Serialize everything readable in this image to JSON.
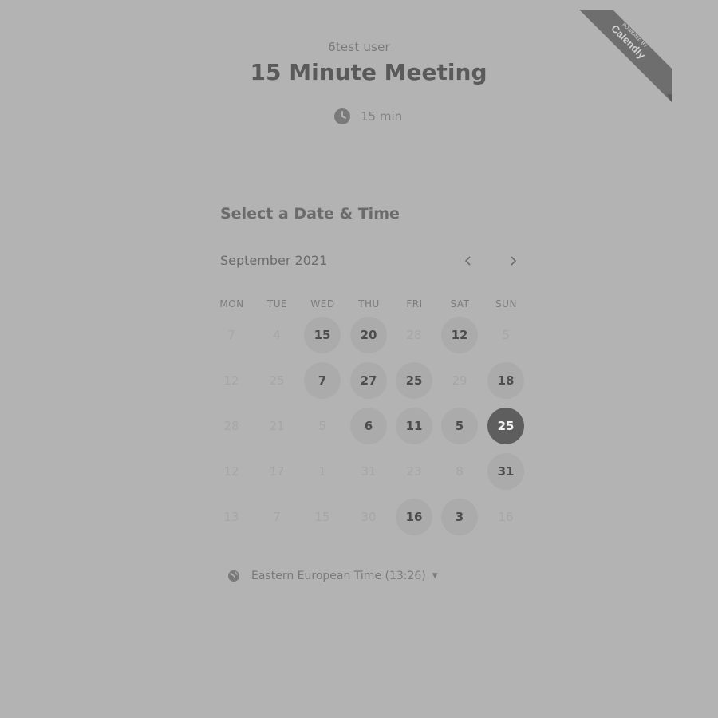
{
  "event": {
    "host": "6test user",
    "title": "15 Minute Meeting",
    "duration": "15 min"
  },
  "badge": {
    "powered_by": "POWERED BY",
    "brand": "Calendly"
  },
  "calendar": {
    "section_title": "Select a Date & Time",
    "month_label": "September 2021",
    "weekdays": [
      "MON",
      "TUE",
      "WED",
      "THU",
      "FRI",
      "SAT",
      "SUN"
    ],
    "weeks": [
      [
        {
          "d": "7",
          "s": "off"
        },
        {
          "d": "4",
          "s": "off"
        },
        {
          "d": "15",
          "s": "avail"
        },
        {
          "d": "20",
          "s": "avail"
        },
        {
          "d": "28",
          "s": "off"
        },
        {
          "d": "12",
          "s": "avail"
        },
        {
          "d": "5",
          "s": "off"
        }
      ],
      [
        {
          "d": "12",
          "s": "off"
        },
        {
          "d": "25",
          "s": "off"
        },
        {
          "d": "7",
          "s": "avail"
        },
        {
          "d": "27",
          "s": "avail"
        },
        {
          "d": "25",
          "s": "avail"
        },
        {
          "d": "29",
          "s": "off"
        },
        {
          "d": "18",
          "s": "avail"
        }
      ],
      [
        {
          "d": "28",
          "s": "off"
        },
        {
          "d": "21",
          "s": "off"
        },
        {
          "d": "5",
          "s": "off"
        },
        {
          "d": "6",
          "s": "avail"
        },
        {
          "d": "11",
          "s": "avail"
        },
        {
          "d": "5",
          "s": "avail"
        },
        {
          "d": "25",
          "s": "sel"
        }
      ],
      [
        {
          "d": "12",
          "s": "off"
        },
        {
          "d": "17",
          "s": "off"
        },
        {
          "d": "1",
          "s": "off"
        },
        {
          "d": "31",
          "s": "off"
        },
        {
          "d": "23",
          "s": "off"
        },
        {
          "d": "8",
          "s": "off"
        },
        {
          "d": "31",
          "s": "avail"
        }
      ],
      [
        {
          "d": "13",
          "s": "off"
        },
        {
          "d": "7",
          "s": "off"
        },
        {
          "d": "15",
          "s": "off"
        },
        {
          "d": "30",
          "s": "off"
        },
        {
          "d": "16",
          "s": "avail"
        },
        {
          "d": "3",
          "s": "avail"
        },
        {
          "d": "16",
          "s": "off"
        }
      ]
    ]
  },
  "timezone": {
    "label": "Eastern European Time (13:26)"
  },
  "colors": {
    "background": "#b3b3b3",
    "available_day": "#ababab",
    "selected_day": "#5e5e5e",
    "badge": "#6e6e6e"
  },
  "icons": {
    "duration": "clock-icon",
    "prev": "chevron-left-icon",
    "next": "chevron-right-icon",
    "timezone": "globe-icon",
    "dropdown": "caret-down-icon"
  }
}
